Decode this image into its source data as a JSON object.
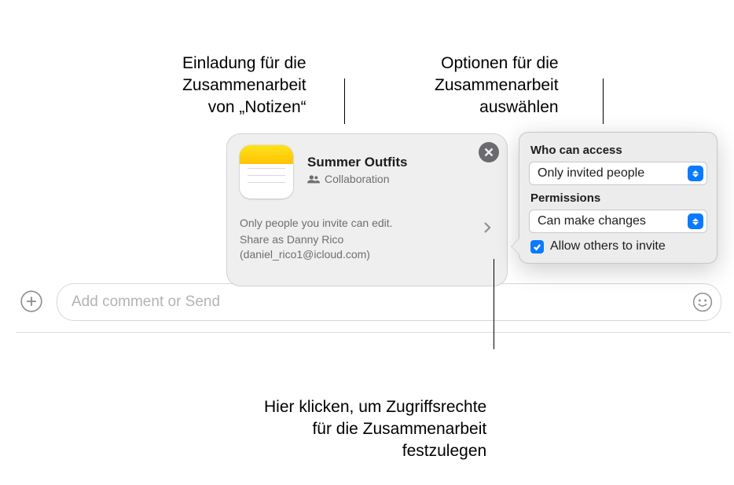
{
  "callouts": {
    "invite": "Einladung für die\nZusammenarbeit\nvon „Notizen“",
    "options": "Optionen für die\nZusammenarbeit\nauswählen",
    "permissions_hint": "Hier klicken, um Zugriffsrechte\nfür die Zusammenarbeit\nfestzulegen"
  },
  "compose": {
    "placeholder": "Add comment or Send"
  },
  "invite_card": {
    "title": "Summer Outfits",
    "subtitle": "Collaboration",
    "detail_line1": "Only people you invite can edit.",
    "detail_line2": "Share as Danny Rico",
    "detail_line3": "(daniel_rico1@icloud.com)"
  },
  "popover": {
    "access_label": "Who can access",
    "access_value": "Only invited people",
    "permissions_label": "Permissions",
    "permissions_value": "Can make changes",
    "allow_invite_label": "Allow others to invite",
    "allow_invite_checked": true
  }
}
